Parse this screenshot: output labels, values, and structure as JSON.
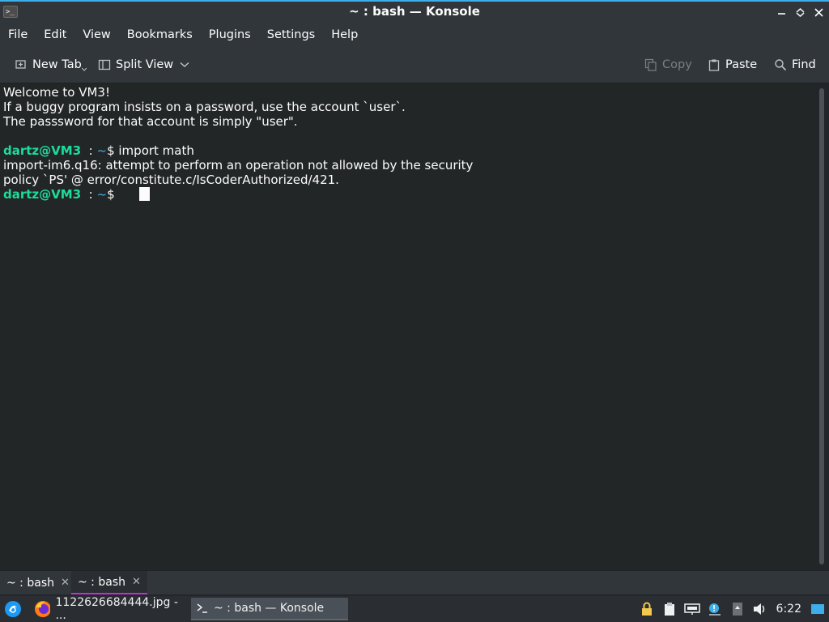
{
  "window": {
    "title": "~ : bash — Konsole",
    "app_icon_glyph": ">_"
  },
  "menubar": {
    "items": [
      "File",
      "Edit",
      "View",
      "Bookmarks",
      "Plugins",
      "Settings",
      "Help"
    ]
  },
  "toolbar": {
    "new_tab": "New Tab",
    "split_view": "Split View",
    "copy": "Copy",
    "paste": "Paste",
    "find": "Find"
  },
  "terminal": {
    "lines": [
      "Welcome to VM3!",
      "If a buggy program insists on a password, use the account `user`.",
      "The passsword for that account is simply \"user\"."
    ],
    "prompt_user": "dartz@VM3",
    "prompt_sep": "  : ",
    "prompt_path": "~",
    "prompt_symbol": "$ ",
    "command": "import math",
    "error_line_1": "import-im6.q16: attempt to perform an operation not allowed by the security",
    "error_line_2": "policy `PS' @ error/constitute.c/IsCoderAuthorized/421."
  },
  "tabs": [
    {
      "label": "~ : bash",
      "active": false
    },
    {
      "label": "~ : bash",
      "active": true
    }
  ],
  "taskbar": {
    "tasks": [
      {
        "label": "1122626684444.jpg - ...",
        "icon": "firefox-icon",
        "active": false
      },
      {
        "label": "~ : bash — Konsole",
        "icon": "konsole-icon",
        "active": true
      }
    ],
    "clock": "6:22"
  },
  "colors": {
    "accent": "#3daee9",
    "prompt_user": "#1cdc9a",
    "tab_active_underline": "#c02fd4",
    "terminal_bg": "#232627"
  }
}
